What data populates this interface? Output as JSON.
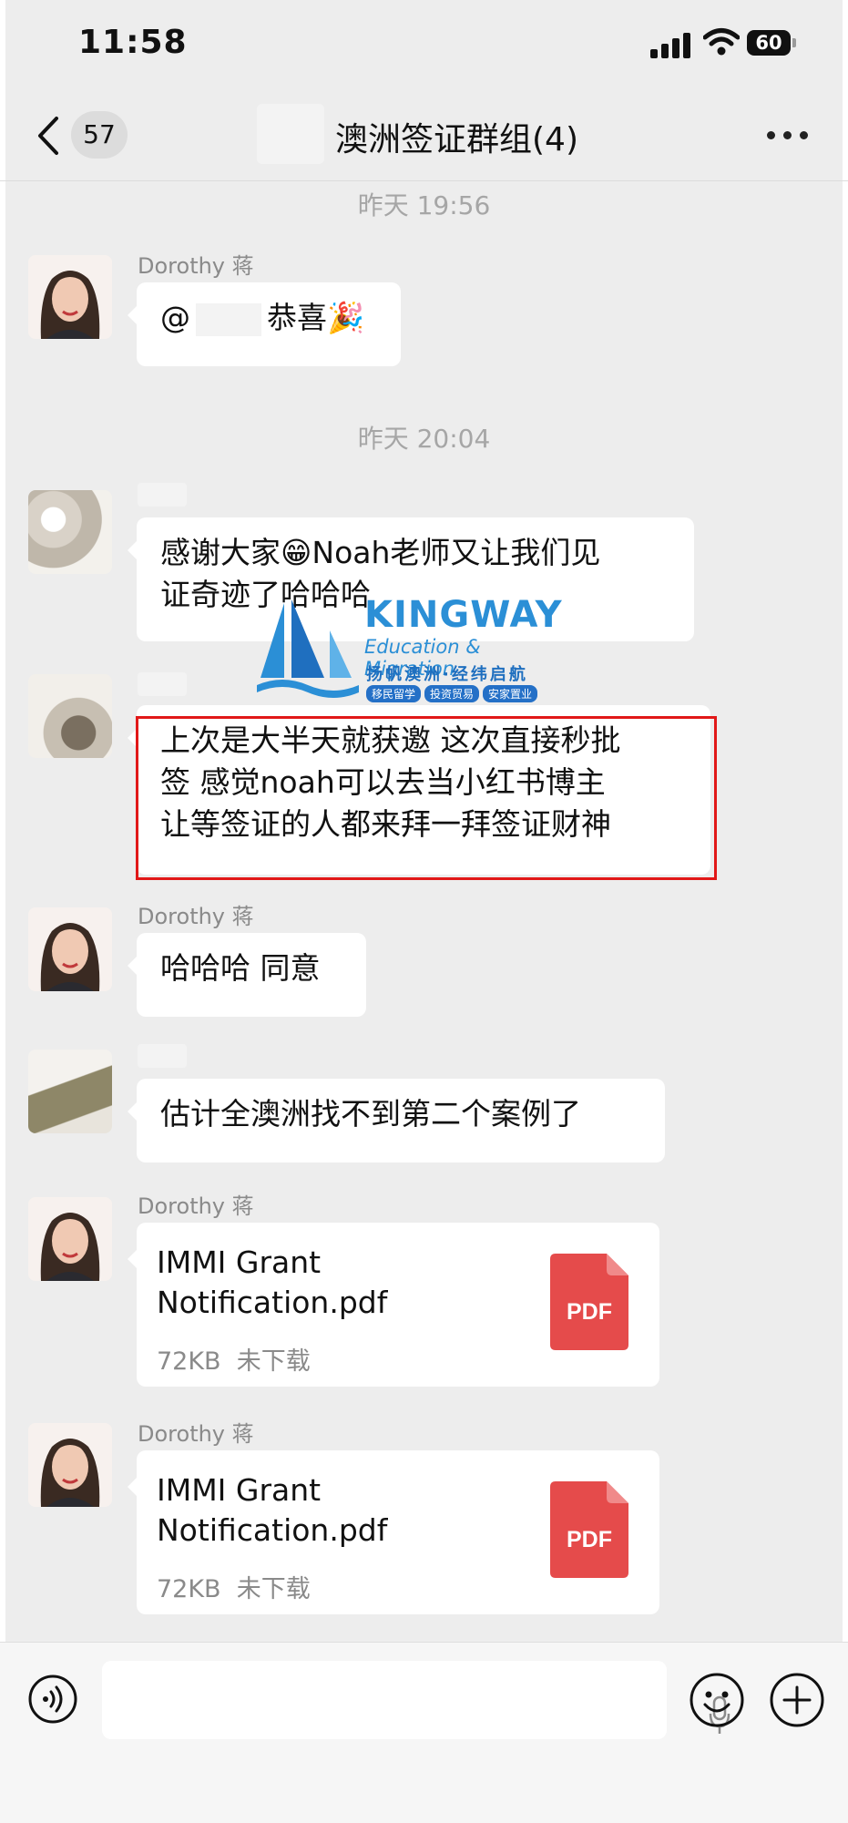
{
  "status_bar": {
    "time": "11:58",
    "battery": "60"
  },
  "nav": {
    "back_count": "57",
    "title": "澳洲签证群组(4)"
  },
  "messages": [
    {
      "type": "timestamp",
      "text": "昨天 19:56"
    },
    {
      "type": "text",
      "sender": "Dorothy 蒋",
      "prefix": "@",
      "text": "恭喜",
      "emoji": "🎉"
    },
    {
      "type": "timestamp",
      "text": "昨天 20:04"
    },
    {
      "type": "text",
      "sender": "",
      "text_a": "感谢大家",
      "emoji": "😁",
      "text_b": "Noah老师又让我们见",
      "line2": "证奇迹了哈哈哈"
    },
    {
      "type": "text",
      "sender": "",
      "lines": [
        "上次是大半天就获邀 这次直接秒批",
        "签 感觉noah可以去当小红书博主",
        "让等签证的人都来拜一拜签证财神"
      ]
    },
    {
      "type": "text",
      "sender": "Dorothy 蒋",
      "text": "哈哈哈 同意"
    },
    {
      "type": "text",
      "sender": "",
      "text": "估计全澳洲找不到第二个案例了"
    },
    {
      "type": "file",
      "sender": "Dorothy 蒋",
      "name_lines": [
        "IMMI Grant",
        "Notification.pdf"
      ],
      "size": "72KB",
      "status": "未下载",
      "icon_label": "PDF"
    },
    {
      "type": "file",
      "sender": "Dorothy 蒋",
      "name_lines": [
        "IMMI Grant",
        "Notification.pdf"
      ],
      "size": "72KB",
      "status": "未下载",
      "icon_label": "PDF"
    }
  ],
  "watermark": {
    "brand": "KINGWAY",
    "subtitle": "Education & Migration",
    "slogan": "扬帆澳洲·经纬启航",
    "tags": [
      "移民留学",
      "投资贸易",
      "安家置业"
    ]
  },
  "icons": {
    "voice": "voice-input-icon",
    "mic": "microphone-icon",
    "emoji": "emoji-icon",
    "plus": "plus-icon",
    "pdf": "pdf-file-icon"
  },
  "colors": {
    "highlight_box": "#e11818",
    "pdf_red": "#e54b4b",
    "brand_blue": "#2b8fd6"
  }
}
